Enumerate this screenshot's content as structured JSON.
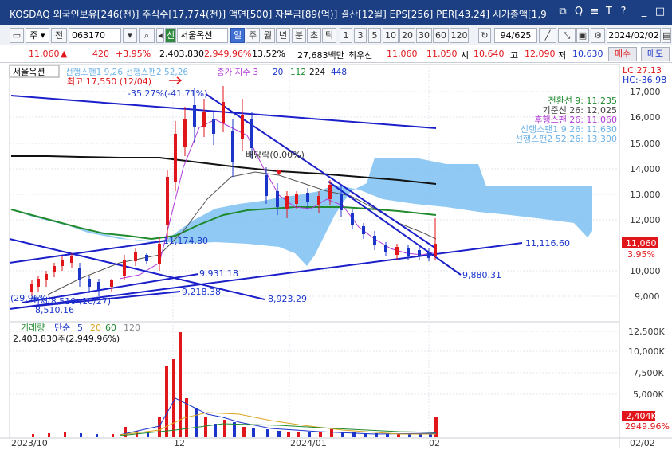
{
  "titlebar": {
    "text": "KOSDAQ 외국인보유[246(천)] 주식수[17,774(천)] 액면[500] 자본금[89(억)] 결산[12월] EPS[256] PER[43.24] 시가총액[1,9"
  },
  "toolbar": {
    "period_select": "주",
    "prev_label": "전",
    "code": "063170",
    "tag": "신",
    "stock_name": "서울옥션",
    "periods": [
      "일",
      "주",
      "월",
      "년",
      "분",
      "초",
      "틱"
    ],
    "active_period": "일",
    "counts": [
      "1",
      "3",
      "5",
      "10",
      "20",
      "30",
      "60",
      "120"
    ],
    "page_counter": "94/625",
    "date": "2024/02/02"
  },
  "price": {
    "current": "11,060",
    "arrow": "▲",
    "change": "420",
    "change_pct": "+3.95%",
    "volume": "2,403,830",
    "volume_pct": "2,949.96%",
    "turnover": "13.52%",
    "amount": "27,683백만",
    "best_ask_label": "최우선",
    "best_ask": "11,060",
    "best_bid": "11,050",
    "open_label": "시",
    "open": "10,640",
    "high_label": "고",
    "high": "12,090",
    "low_label": "저",
    "low": "10,630",
    "buy_label": "매수",
    "sell_label": "매도"
  },
  "chart_legend": {
    "stock": "서울옥션",
    "leading_span": "선행스팬1 9,26  선행스팬2 52,26",
    "closing_index": "종가 지수 3",
    "ma_20": "20",
    "ma_112": "112",
    "ma_224": "224",
    "ma_448": "448",
    "high_note": "최고 17,550 (12/04)",
    "high_drop": "-35.27%(-41.71%)",
    "dividend": "배당락(0.00%)",
    "low_note": "최저 8,510 (10/27)",
    "low_pct": "(29.96%)",
    "lc": "LC:27.13",
    "hc": "HC:-36.98"
  },
  "ichimoku": {
    "conversion": "전환선 9: 11,235",
    "base": "기준선 26: 12,025",
    "lagging": "후행스팬 26: 11,060",
    "span1": "선행스팬1 9,26: 11,630",
    "span2": "선행스팬2 52,26: 13,300"
  },
  "trendline_labels": {
    "a": "11,174.80",
    "b": "11,116.60",
    "c": "9,931.18",
    "d": "9,218.38",
    "e": "8,923.29",
    "f": "9,880.31",
    "g": "8,510.16"
  },
  "price_axis": {
    "ticks": [
      "17,000",
      "16,000",
      "15,000",
      "14,000",
      "13,000",
      "12,000",
      "10,000",
      "9,000"
    ],
    "current_tag": "11,060",
    "current_pct": "3.95%"
  },
  "volume_panel": {
    "title": "거래량",
    "ma_label": "단순",
    "ma_5": "5",
    "ma_20": "20",
    "ma_60": "60",
    "ma_120": "120",
    "today": "2,403,830주(2,949.96%)",
    "axis_ticks": [
      "12,500K",
      "10,000K",
      "7,500K",
      "5,000K"
    ],
    "current_tag": "2,404K",
    "current_pct": "2949.96%"
  },
  "date_axis": [
    "2023/10",
    "12",
    "2024/01",
    "02",
    "02/02"
  ],
  "colors": {
    "titlebar": "#1b3f82",
    "up": "#e0161b",
    "down": "#1b35c9",
    "cloud": "#7cc1f2",
    "ma_black": "#111111",
    "ma_green": "#1f8a2e"
  }
}
